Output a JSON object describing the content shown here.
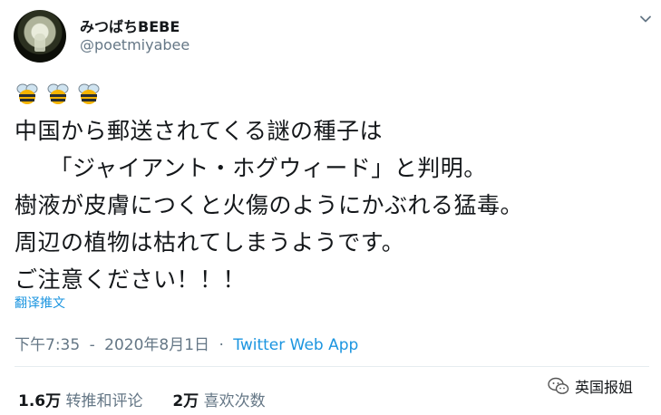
{
  "user": {
    "display_name": "みつばちBEBE",
    "handle": "@poetmiyabee"
  },
  "tweet": {
    "emoji": [
      "bee",
      "bee",
      "bee"
    ],
    "text": "中国から郵送されてくる謎の種子は\n　　「ジャイアント・ホグウィード」と判明。\n樹液が皮膚につくと火傷のようにかぶれる猛毒。\n周辺の植物は枯れてしまうようです。\nご注意ください！！！",
    "translate_label": "翻译推文"
  },
  "meta": {
    "time": "下午7:35",
    "separator": "·",
    "date": "2020年8月1日",
    "source": "Twitter Web App"
  },
  "stats": {
    "retweets_count": "1.6万",
    "retweets_label": "转推和评论",
    "likes_count": "2万",
    "likes_label": "喜欢次数"
  },
  "watermark": {
    "text": "英国报姐",
    "icon": "wechat-icon"
  },
  "colors": {
    "link": "#1b95e0",
    "secondary_text": "#657786",
    "divider": "#e6ecf0"
  }
}
